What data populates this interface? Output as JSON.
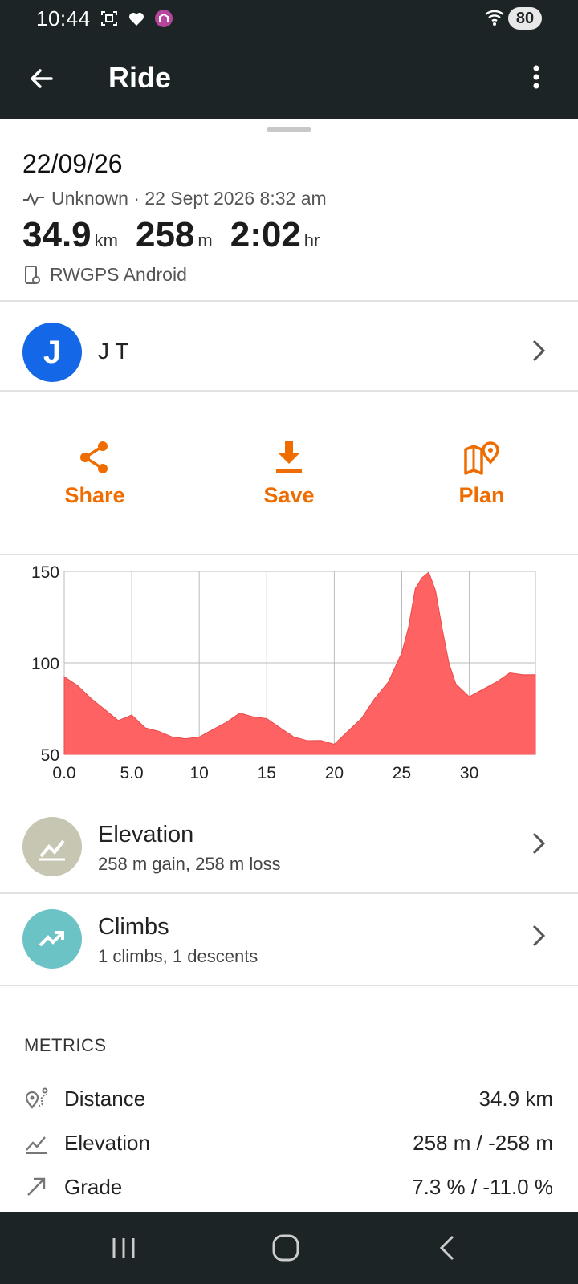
{
  "status_bar": {
    "time": "10:44",
    "battery": "80"
  },
  "app_bar": {
    "title": "Ride"
  },
  "ride": {
    "date": "22/09/26",
    "activity_line": "Unknown · 22 Sept 2026 8:32 am",
    "distance": {
      "value": "34.9",
      "unit": "km"
    },
    "elevation": {
      "value": "258",
      "unit": "m"
    },
    "duration": {
      "value": "2:02",
      "unit": "hr"
    },
    "device": "RWGPS Android"
  },
  "user": {
    "initial": "J",
    "name": "J T"
  },
  "actions": [
    {
      "label": "Share",
      "icon": "share-icon"
    },
    {
      "label": "Save",
      "icon": "download-icon"
    },
    {
      "label": "Plan",
      "icon": "map-pin-icon"
    }
  ],
  "colors": {
    "accent": "#ef6c00",
    "chart_fill": "#ff6262",
    "topbar": "#1c2426",
    "avatar": "#1467e6",
    "elevation_badge": "#c7c6b2",
    "climbs_badge": "#6cc3c6"
  },
  "chart_data": {
    "type": "area",
    "title": "",
    "xlabel": "",
    "ylabel": "",
    "xlim": [
      0,
      34.9
    ],
    "ylim": [
      50,
      150
    ],
    "x_ticks": [
      "0.0",
      "5.0",
      "10",
      "15",
      "20",
      "25",
      "30"
    ],
    "y_ticks": [
      "150",
      "100",
      "50"
    ],
    "grid": true,
    "x": [
      0,
      1,
      2,
      3,
      4,
      5,
      6,
      7,
      8,
      9,
      10,
      11,
      12,
      13,
      14,
      15,
      16,
      17,
      18,
      19,
      20,
      21,
      22,
      23,
      24,
      25,
      25.5,
      26,
      26.5,
      27,
      27.5,
      28,
      28.5,
      29,
      30,
      31,
      32,
      33,
      34,
      34.9
    ],
    "y": [
      93,
      87,
      81,
      74,
      69,
      71,
      65,
      62,
      60,
      58,
      60,
      63,
      68,
      72,
      71,
      69,
      65,
      59,
      58,
      57,
      56,
      62,
      70,
      80,
      90,
      105,
      120,
      140,
      147,
      149,
      140,
      118,
      100,
      88,
      82,
      85,
      90,
      94,
      94,
      93
    ]
  },
  "elevation_row": {
    "title": "Elevation",
    "subtitle": "258 m gain, 258 m loss"
  },
  "climbs_row": {
    "title": "Climbs",
    "subtitle": "1 climbs, 1 descents"
  },
  "metrics": {
    "heading": "METRICS",
    "rows": [
      {
        "label": "Distance",
        "value": "34.9 km",
        "icon": "distance-icon"
      },
      {
        "label": "Elevation",
        "value": "258 m / -258 m",
        "icon": "elevation-icon"
      },
      {
        "label": "Grade",
        "value": "7.3 % / -11.0 %",
        "icon": "grade-icon"
      }
    ]
  }
}
